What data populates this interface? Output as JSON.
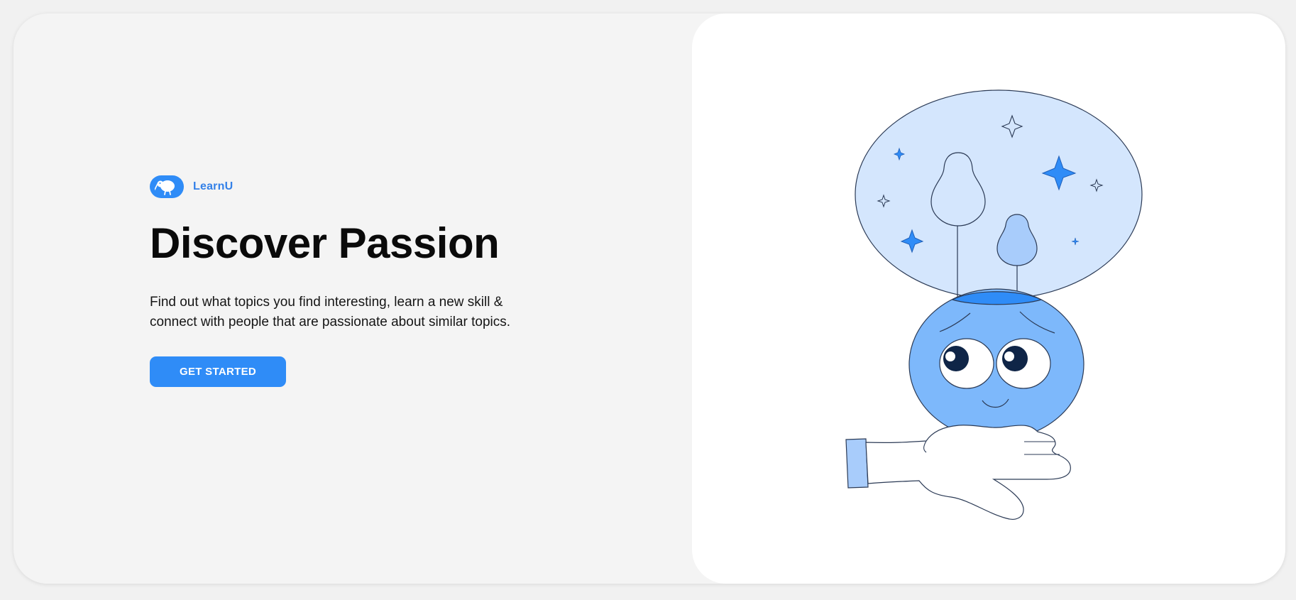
{
  "brand": {
    "name": "LearnU",
    "logo_icon": "kiwi-bird-icon",
    "accent_color": "#2f8cf7"
  },
  "hero": {
    "headline": "Discover Passion",
    "description": "Find out what topics you find interesting, learn a new skill & connect with people that are passionate about similar topics.",
    "cta_label": "GET STARTED"
  },
  "illustration": {
    "subject": "idea-head-illustration",
    "colors": {
      "bubble": "#d4e6fd",
      "head": "#7db8fb",
      "accent": "#2f8cf7",
      "outline": "#2b3a55"
    }
  }
}
